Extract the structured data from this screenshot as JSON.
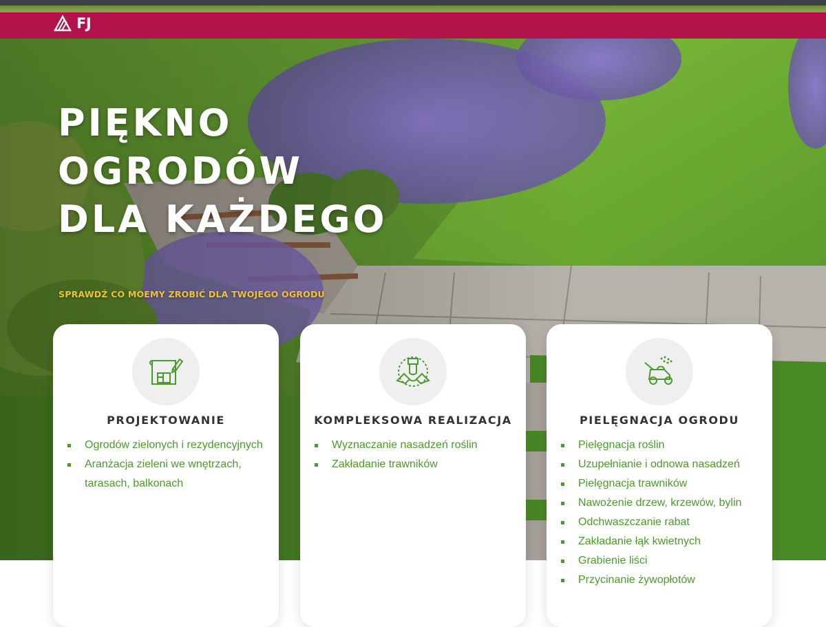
{
  "brand": {
    "logo_text": "FJ"
  },
  "hero": {
    "title_lines": [
      "PIĘKNO",
      "OGRODÓW",
      "DLA KAŻDEGO"
    ],
    "subtitle": "SPRAWDŹ CO MOEMY ZROBIĆ DLA TWOJEGO OGRODU"
  },
  "cards": [
    {
      "icon": "blueprint-pencil-icon",
      "title": "PROJEKTOWANIE",
      "items": [
        "Ogrodów zielonych i rezydencyjnych",
        "Aranżacja zieleni we wnętrzach, tarasach, balkonach"
      ]
    },
    {
      "icon": "hands-plant-icon",
      "title": "KOMPLEKSOWA REALIZACJA",
      "items": [
        "Wyznaczanie nasadzeń roślin",
        "Zakładanie trawników"
      ]
    },
    {
      "icon": "lawn-mower-icon",
      "title": "PIELĘGNACJA OGRODU",
      "items": [
        "Pielęgnacja roślin",
        "Uzupełnianie i odnowa nasadzeń",
        "Pielęgnacja trawników",
        "Nawożenie drzew, krzewów, bylin",
        "Odchwaszczanie rabat",
        "Zakładanie łąk kwietnych",
        "Grabienie liści",
        "Przycinanie żywopłotów"
      ]
    }
  ],
  "colors": {
    "topbar": "#b3124a",
    "accent_green": "#4b9a2c",
    "subtitle_yellow": "#f2c230"
  }
}
